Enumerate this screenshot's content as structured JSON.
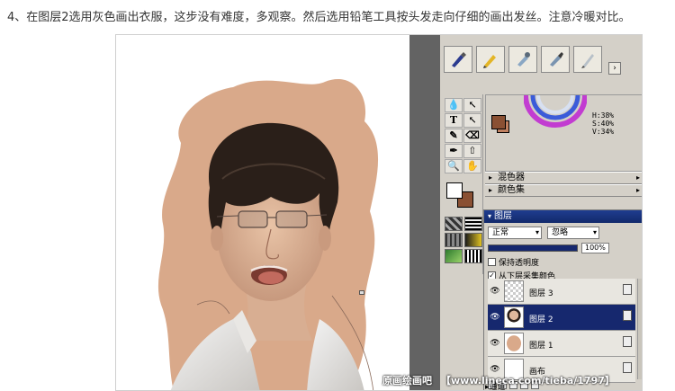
{
  "caption": "4、在图层2选用灰色画出衣服，这步没有难度，多观察。然后选用铅笔工具按头发走向仔细的画出发丝。注意冷暖对比。",
  "colors": {
    "accent": "#16286e",
    "skin": "#d9a98a",
    "hair": "#2a1f19",
    "background_swatch": "#8a5033"
  },
  "brush_tools": [
    {
      "name": "ink-pen-icon"
    },
    {
      "name": "pencil-icon"
    },
    {
      "name": "airbrush-icon"
    },
    {
      "name": "marker-icon"
    },
    {
      "name": "fine-pen-icon"
    }
  ],
  "toolbox": {
    "tools": [
      "💧",
      "↖",
      "T",
      "↖",
      "✎",
      "⌫",
      "✒",
      "⇧",
      "🔍",
      "✋"
    ]
  },
  "color_panel": {
    "h": "H:38%",
    "s": "S:40%",
    "v": "V:34%"
  },
  "mixer_label": "混色器",
  "color_set_label": "颜色集",
  "layers_panel": {
    "title": "图层",
    "blend_mode": "正常",
    "option": "忽略",
    "opacity": "100%",
    "preserve_transparency": "保持透明度",
    "sample_below": "从下层采集颜色",
    "layers": [
      {
        "name": "图层 3",
        "selected": false
      },
      {
        "name": "图层 2",
        "selected": true
      },
      {
        "name": "图层 1",
        "selected": false
      },
      {
        "name": "画布",
        "selected": false
      }
    ]
  },
  "channels_label": "通道",
  "watermark": {
    "logo": "原画绘画吧",
    "url": "【www.lineca.com/tieba/1797】"
  }
}
